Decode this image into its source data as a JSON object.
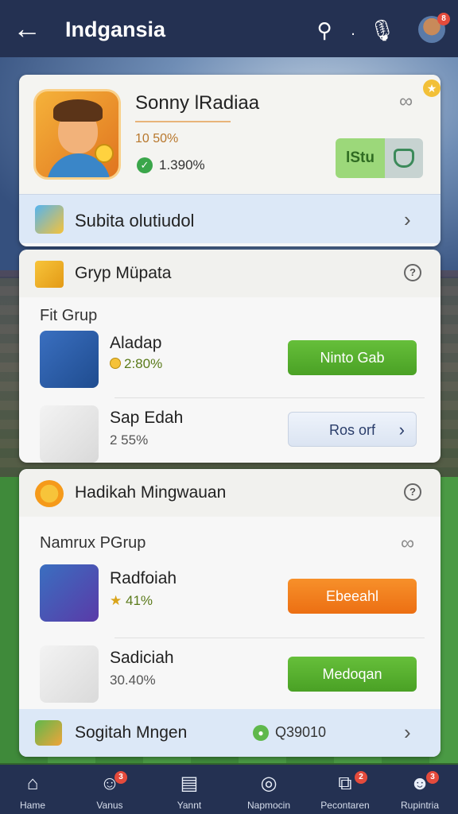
{
  "header": {
    "title": "Indgansia",
    "back_icon": "back-arrow-icon",
    "actions": [
      "search-icon",
      "dot-icon",
      "microphone-icon"
    ],
    "avatar_badge": "8"
  },
  "profile": {
    "name": "Sonny lRadiaa",
    "score": "10 50%",
    "rating": "1.390%",
    "status_label": "lStu",
    "subscription_label": "Subita olutiudol"
  },
  "group_section": {
    "title": "Gryp Müpata",
    "help": "?",
    "subheader": "Fit Grup",
    "items": [
      {
        "name": "Aladap",
        "stat": "2:80%",
        "button": "Ninto Gab",
        "button_style": "green"
      },
      {
        "name": "Sap Edah",
        "stat": "2 55%",
        "button": "Ros orf",
        "button_style": "light"
      }
    ]
  },
  "ranking_section": {
    "title": "Hadikah Mingwauan",
    "help": "?",
    "subheader": "Namrux PGrup",
    "items": [
      {
        "name": "Radfoiah",
        "stat": "41%",
        "button": "Ebeeahl",
        "button_style": "orange"
      },
      {
        "name": "Sadiciah",
        "stat": "30.40%",
        "button": "Medoqan",
        "button_style": "green"
      }
    ],
    "bottom": {
      "label": "Sogitah Mngen",
      "value": "Q39010"
    }
  },
  "nav": {
    "items": [
      {
        "label": "Hame",
        "icon": "home-icon",
        "badge": ""
      },
      {
        "label": "Vanus",
        "icon": "users-icon",
        "badge": "3"
      },
      {
        "label": "Yannt",
        "icon": "ranking-icon",
        "badge": ""
      },
      {
        "label": "Napmocin",
        "icon": "chat-icon",
        "badge": ""
      },
      {
        "label": "Pecontaren",
        "icon": "upload-icon",
        "badge": "2"
      },
      {
        "label": "Rupintria",
        "icon": "profile-icon",
        "badge": "3"
      }
    ]
  },
  "colors": {
    "header_bg": "#243152",
    "accent_green": "#4aa125",
    "accent_orange": "#ec6f13",
    "highlight_blue": "#dce8f7"
  }
}
